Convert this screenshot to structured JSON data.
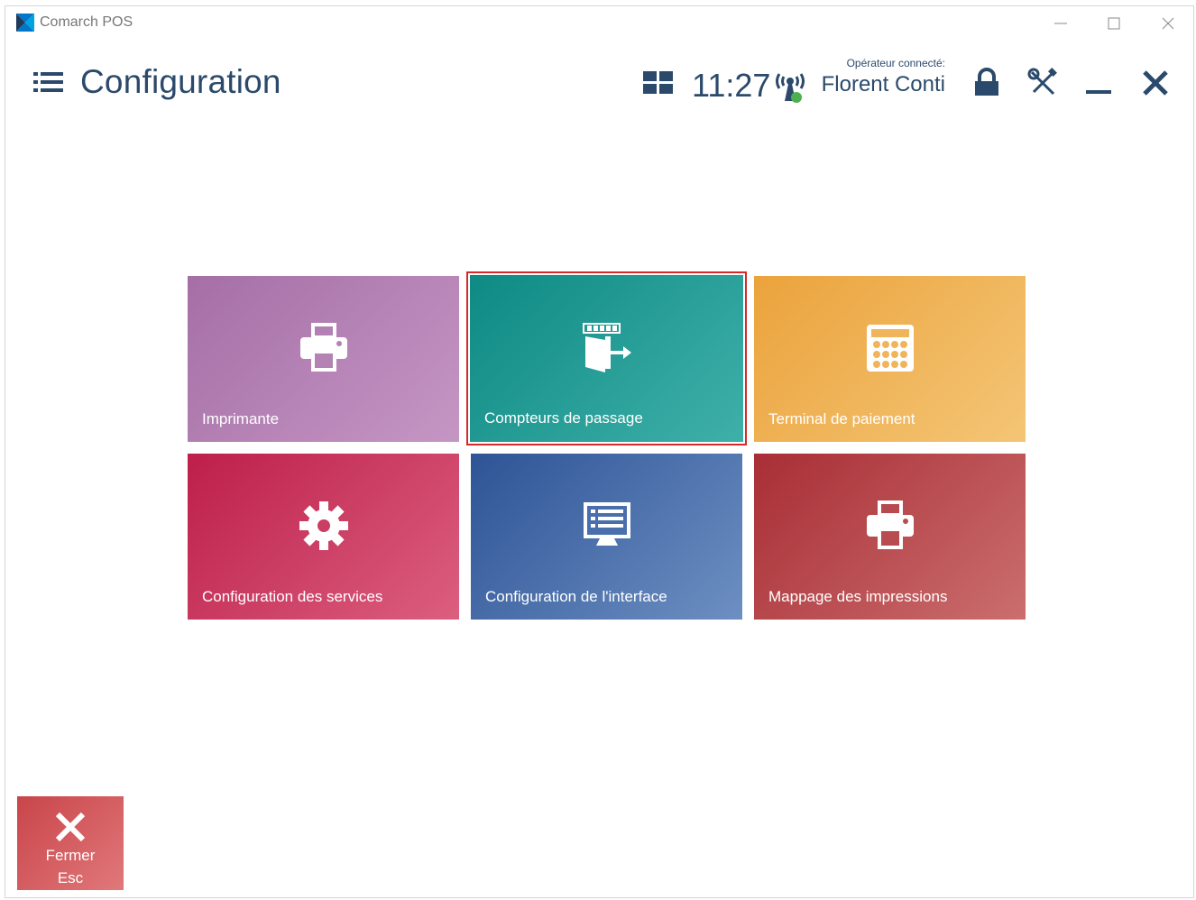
{
  "window": {
    "title": "Comarch POS",
    "controls": [
      "minimize",
      "maximize",
      "close"
    ]
  },
  "header": {
    "page_title": "Configuration",
    "clock": "11:27",
    "operator_label": "Opérateur connecté:",
    "operator_name": "Florent Conti",
    "icons": [
      "menu-icon",
      "tiles-icon",
      "signal-icon",
      "lock-icon",
      "tools-icon",
      "minimize-icon",
      "close-icon"
    ]
  },
  "tiles": [
    {
      "label": "Imprimante",
      "icon": "printer-icon",
      "color": "#b482b3"
    },
    {
      "label": "Compteurs de passage",
      "icon": "counter-door-icon",
      "color": "#1f9c95",
      "selected": true
    },
    {
      "label": "Terminal de paiement",
      "icon": "calculator-icon",
      "color": "#f0b55a"
    },
    {
      "label": "Configuration des services",
      "icon": "gear-icon",
      "color": "#cc3d63"
    },
    {
      "label": "Configuration de l'interface",
      "icon": "screen-icon",
      "color": "#4a6fad"
    },
    {
      "label": "Mappage des impressions",
      "icon": "printer-icon",
      "color": "#b94c51"
    }
  ],
  "footer": {
    "close_label": "Fermer",
    "close_key": "Esc"
  },
  "colors": {
    "accent": "#2b4a6b",
    "selection_border": "#d42a2a",
    "close_panel": "#d35f61"
  }
}
